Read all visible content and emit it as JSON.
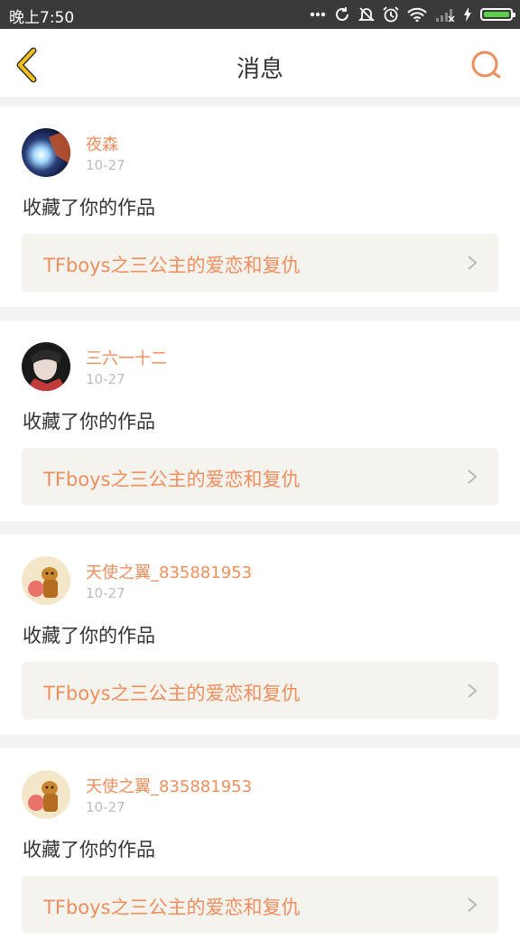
{
  "status_bar": {
    "time": "晚上7:50",
    "battery_level": 1.0,
    "icons": [
      "more-dots-icon",
      "sync-icon",
      "no-notification-icon",
      "alarm-icon",
      "wifi-icon",
      "signal-icon",
      "charging-icon",
      "battery-icon"
    ]
  },
  "header": {
    "title": "消息",
    "back_icon": "chevron-left-icon",
    "search_icon": "search-icon"
  },
  "colors": {
    "accent": "#f08e5e",
    "back_yellow": "#f4c21a"
  },
  "messages": [
    {
      "username": "夜森",
      "date": "10-27",
      "action": "收藏了你的作品",
      "work_title": "TFboys之三公主的爱恋和复仇",
      "avatar": "avatar-1"
    },
    {
      "username": "三六一十二",
      "date": "10-27",
      "action": "收藏了你的作品",
      "work_title": "TFboys之三公主的爱恋和复仇",
      "avatar": "avatar-2"
    },
    {
      "username": "天使之翼_835881953",
      "date": "10-27",
      "action": "收藏了你的作品",
      "work_title": "TFboys之三公主的爱恋和复仇",
      "avatar": "avatar-3"
    },
    {
      "username": "天使之翼_835881953",
      "date": "10-27",
      "action": "收藏了你的作品",
      "work_title": "TFboys之三公主的爱恋和复仇",
      "avatar": "avatar-3"
    }
  ]
}
